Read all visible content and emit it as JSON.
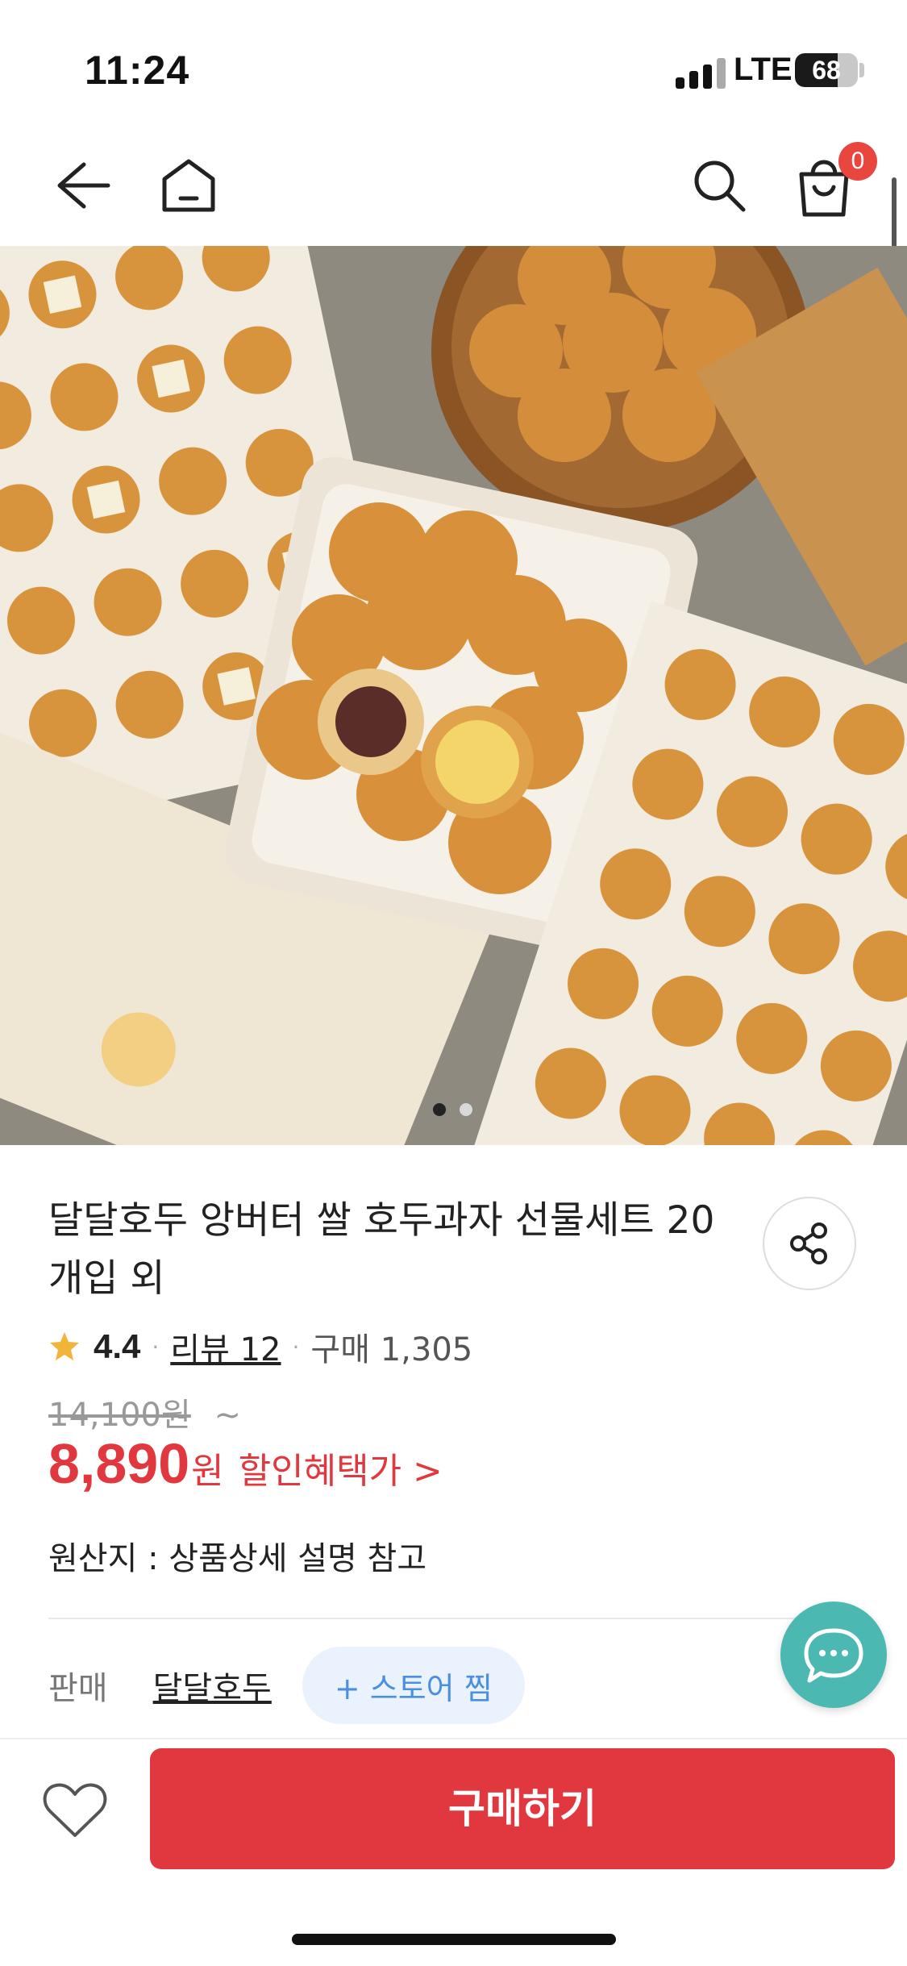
{
  "status_bar": {
    "time": "11:24",
    "network": "LTE",
    "battery": "68",
    "battery_level": 0.68
  },
  "nav": {
    "back_icon": "back-arrow-icon",
    "home_icon": "home-icon",
    "search_icon": "search-icon",
    "cart_icon": "shopping-bag-icon",
    "cart_count": "0"
  },
  "gallery": {
    "image_alt": "walnut cookie gift set photo",
    "page_count": 2,
    "current_page": 1
  },
  "product": {
    "title": "달달호두 앙버터 쌀 호두과자 선물세트 20개입 외",
    "rating": "4.4",
    "reviews_label": "리뷰 12",
    "purchases_label": "구매 1,305",
    "original_price": "14,100",
    "original_price_unit": "원",
    "original_price_suffix": "~",
    "sale_price": "8,890",
    "sale_price_unit": "원",
    "benefit_label": "할인혜택가 >",
    "origin": "원산지 : 상품상세 설명 참고"
  },
  "seller": {
    "label": "판매",
    "name": "달달호두",
    "follow_label": "+ 스토어 찜"
  },
  "actions": {
    "buy_label": "구매하기",
    "wish_icon": "heart-icon",
    "share_icon": "share-icon",
    "chat_icon": "chat-icon"
  },
  "colors": {
    "accent_red": "#e0383e",
    "badge_red": "#e8463f",
    "chat_teal": "#4bb9b1",
    "follow_blue": "#4a8fe0"
  }
}
